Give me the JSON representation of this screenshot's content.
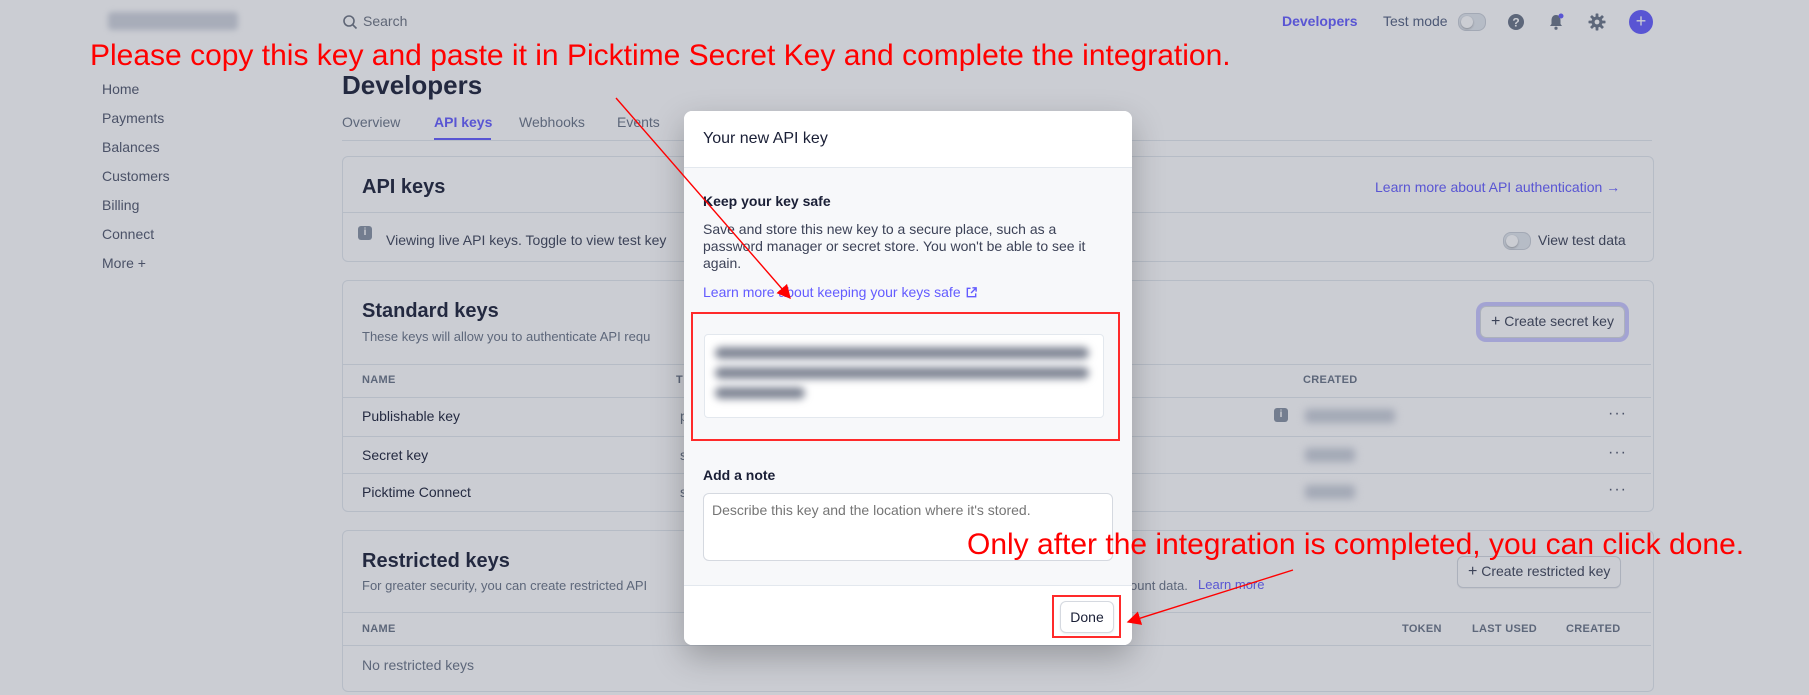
{
  "topbar": {
    "search_placeholder": "Search",
    "developers_link": "Developers",
    "test_mode_label": "Test mode"
  },
  "sidebar": {
    "items": [
      {
        "label": "Home"
      },
      {
        "label": "Payments"
      },
      {
        "label": "Balances"
      },
      {
        "label": "Customers"
      },
      {
        "label": "Billing"
      },
      {
        "label": "Connect"
      },
      {
        "label": "More +"
      }
    ]
  },
  "page": {
    "title": "Developers",
    "tabs": [
      {
        "label": "Overview"
      },
      {
        "label": "API keys"
      },
      {
        "label": "Webhooks"
      },
      {
        "label": "Events"
      }
    ]
  },
  "api_keys_card": {
    "title": "API keys",
    "learn_more": "Learn more about API authentication →",
    "notice": "Viewing live API keys. Toggle to view test key",
    "view_test_data": "View test data"
  },
  "standard_keys": {
    "title": "Standard keys",
    "subtitle": "These keys will allow you to authenticate API requ",
    "create_button": "Create secret key",
    "columns": {
      "name": "NAME",
      "token": "T",
      "created": "CREATED"
    },
    "rows": [
      {
        "name": "Publishable key",
        "token_prefix": "p"
      },
      {
        "name": "Secret key",
        "token_prefix": "s"
      },
      {
        "name": "Picktime Connect",
        "token_prefix": "s"
      }
    ],
    "row_menu": "···"
  },
  "restricted_keys": {
    "title": "Restricted keys",
    "subtitle": "For greater security, you can create restricted API",
    "subtitle_tail": "ount data.",
    "learn_more": "Learn more",
    "create_button": "Create restricted key",
    "columns": {
      "name": "NAME",
      "token": "TOKEN",
      "last_used": "LAST USED",
      "created": "CREATED"
    },
    "empty": "No restricted keys"
  },
  "modal": {
    "title": "Your new API key",
    "safe_heading": "Keep your key safe",
    "safe_text": "Save and store this new key to a secure place, such as a password manager or secret store. You won't be able to see it again.",
    "safe_link": "Learn more about keeping your keys safe",
    "note_heading": "Add a note",
    "note_placeholder": "Describe this key and the location where it's stored.",
    "done_button": "Done"
  },
  "annotations": {
    "top": "Please copy this key and paste it in Picktime Secret Key and complete the integration.",
    "bottom": "Only after the integration is completed, you can click done."
  },
  "colors": {
    "accent": "#635bff",
    "annotation": "#ff0000"
  }
}
